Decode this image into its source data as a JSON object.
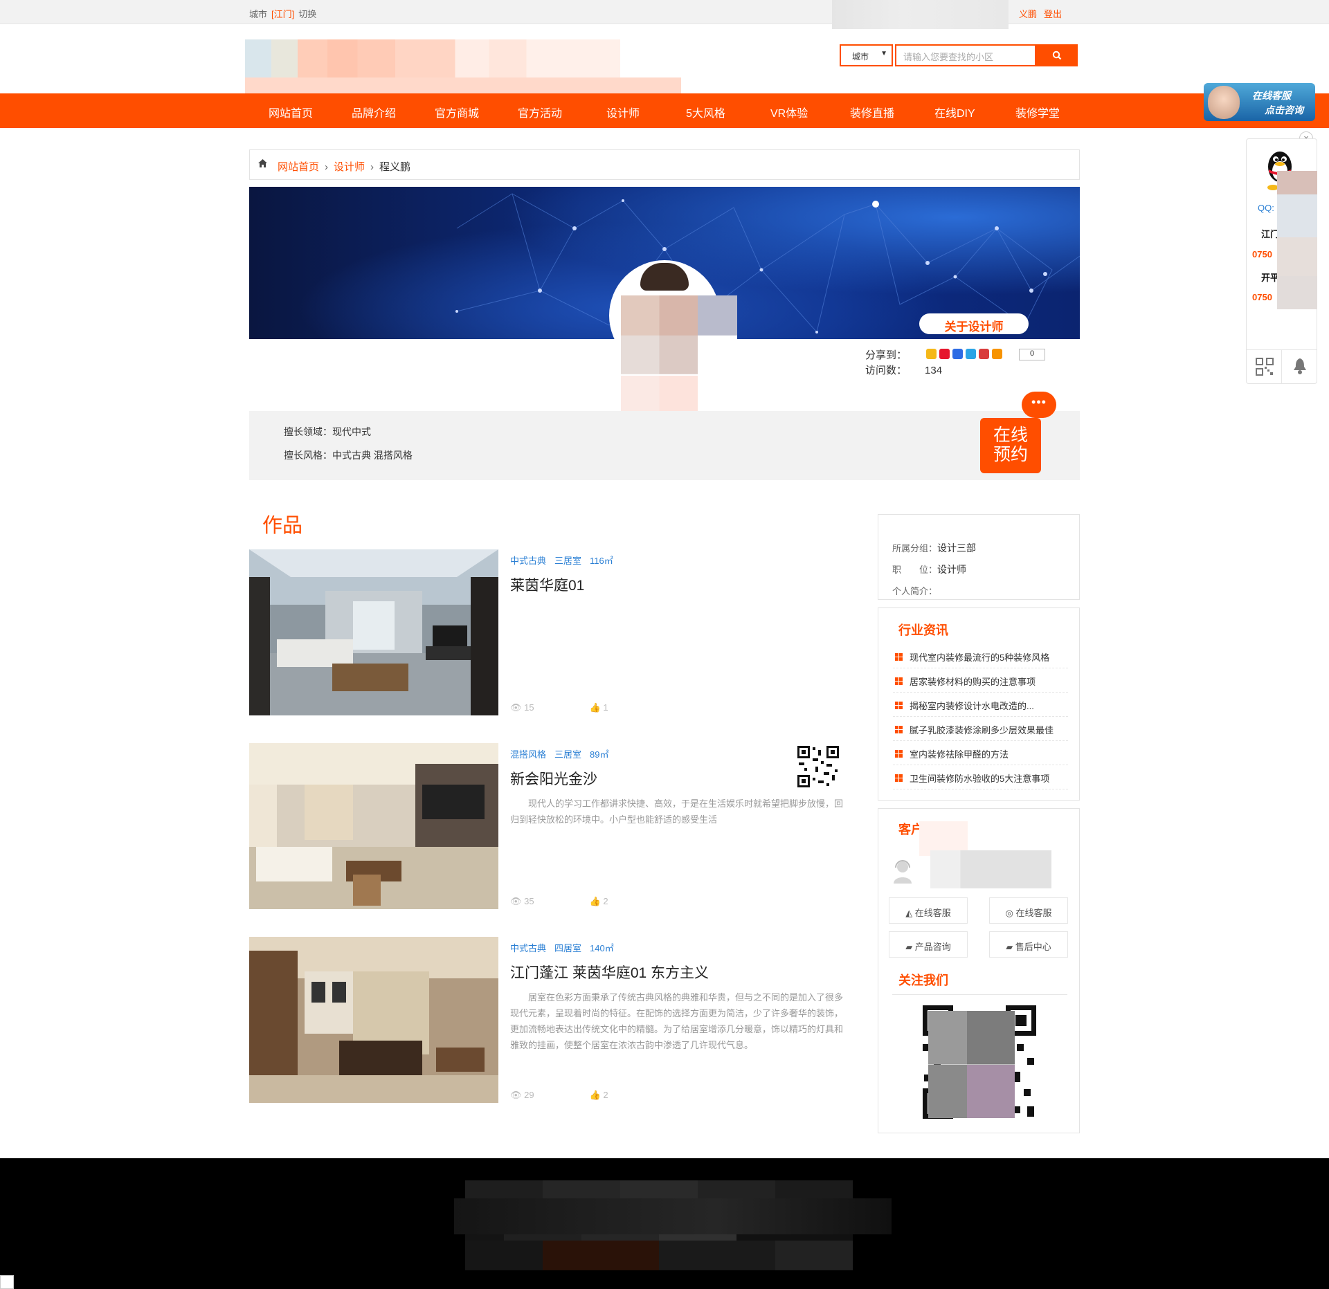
{
  "topbar": {
    "city_label": "城市",
    "city_current": "[江门]",
    "switch_label": "切换",
    "user_name": "义鹏",
    "logout": "登出"
  },
  "header": {
    "city_select": "城市",
    "search_placeholder": "请输入您要查找的小区"
  },
  "nav": [
    "网站首页",
    "品牌介绍",
    "官方商城",
    "官方活动",
    "设计师",
    "5大风格",
    "VR体验",
    "装修直播",
    "在线DIY",
    "装修学堂"
  ],
  "kefu_banner": {
    "line1": "在线客服",
    "line2": "点击咨询"
  },
  "breadcrumb": {
    "home": "网站首页",
    "section": "设计师",
    "current": "程义鹏"
  },
  "profile": {
    "about_button": "关于设计师",
    "share_label": "分享到：",
    "share_count": "0",
    "visits_label": "访问数：",
    "visits_value": "134",
    "expertise_field": "擅长领域：现代中式",
    "expertise_style": "擅长风格：中式古典 混搭风格",
    "booking_bubble": "•••",
    "booking_line1": "在线",
    "booking_line2": "预约"
  },
  "works": {
    "title": "作品",
    "items": [
      {
        "style": "中式古典",
        "rooms": "三居室",
        "area": "116㎡",
        "title": "莱茵华庭01",
        "desc": "",
        "views": "15",
        "likes": "1"
      },
      {
        "style": "混搭风格",
        "rooms": "三居室",
        "area": "89㎡",
        "title": "新会阳光金沙",
        "desc": "现代人的学习工作都讲求快捷、高效，于是在生活娱乐时就希望把脚步放慢，回归到轻快放松的环境中。小户型也能舒适的感受生活",
        "views": "35",
        "likes": "2"
      },
      {
        "style": "中式古典",
        "rooms": "四居室",
        "area": "140㎡",
        "title": "江门蓬江 莱茵华庭01 东方主义",
        "desc": "居室在色彩方面秉承了传统古典风格的典雅和华贵，但与之不同的是加入了很多现代元素，呈现着时尚的特征。在配饰的选择方面更为简洁，少了许多奢华的装饰，更加流畅地表达出传统文化中的精髓。为了给居室增添几分暖意，饰以精巧的灯具和雅致的挂画，使整个居室在浓浓古韵中渗透了几许现代气息。",
        "views": "29",
        "likes": "2"
      }
    ]
  },
  "sidebar": {
    "group_label": "所属分组：",
    "group_value": "设计三部",
    "position_label": "职　　位：",
    "position_value": "设计师",
    "intro_label": "个人简介：",
    "news_title": "行业资讯",
    "news": [
      "现代室内装修最流行的5种装修风格",
      "居家装修材料的购买的注意事项",
      "揭秘室内装修设计水电改造的...",
      "腻子乳胶漆装修涂刷多少层效果最佳",
      "室内装修祛除甲醛的方法",
      "卫生间装修防水验收的5大注意事项"
    ],
    "cs_title": "客户",
    "cs_buttons": [
      "在线客服",
      "在线客服",
      "产品咨询",
      "售后中心"
    ],
    "follow_title": "关注我们"
  },
  "float": {
    "close": "×",
    "qq": "QQ:",
    "city1": "江门",
    "tel1": "0750",
    "city2": "开平",
    "tel2": "0750"
  },
  "colors": {
    "brand": "#ff4e00",
    "nav_bg": "#ff4e00",
    "link": "#2a7fd4",
    "footer": "#000000"
  }
}
